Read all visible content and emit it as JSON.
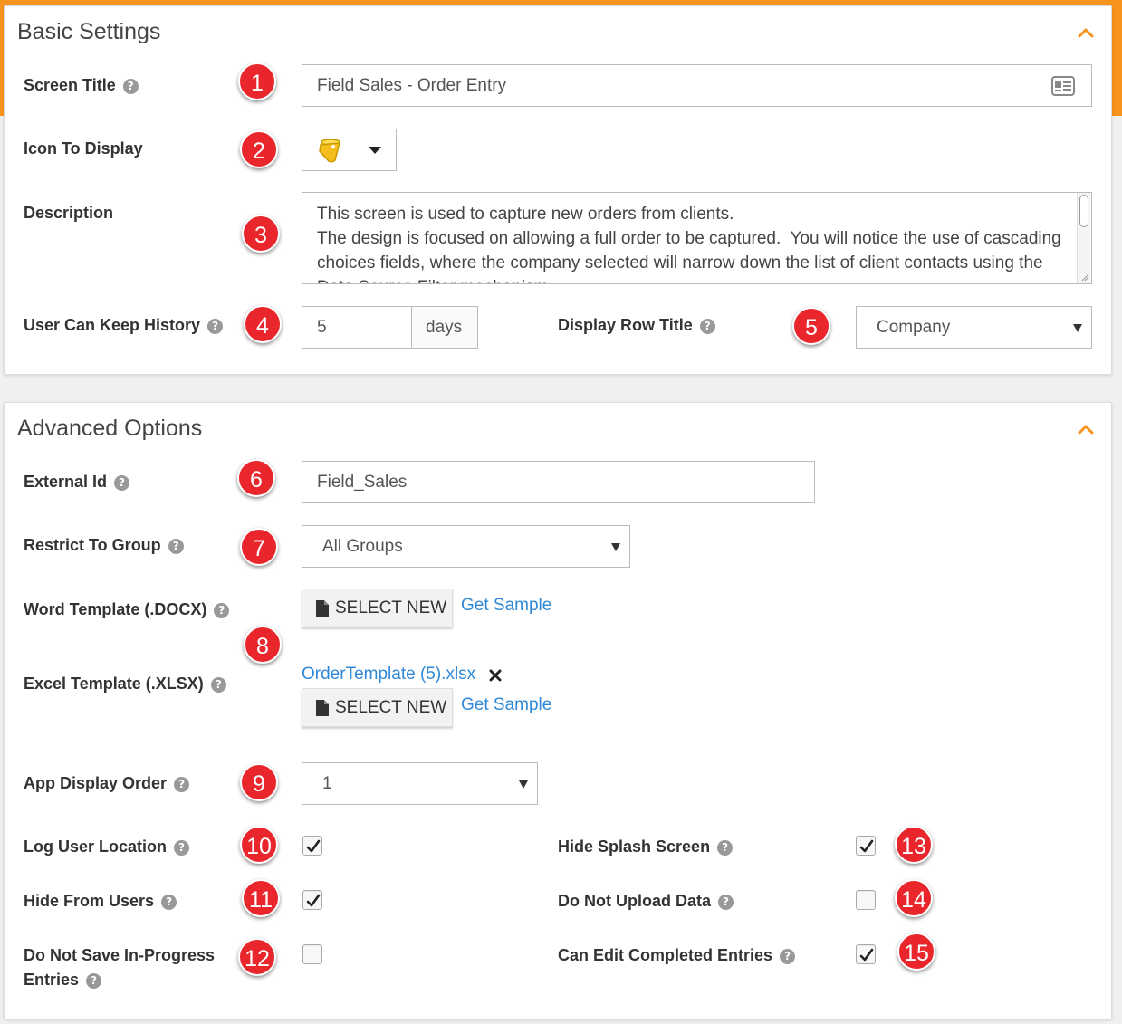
{
  "basic": {
    "title": "Basic Settings",
    "screen_title": {
      "label": "Screen Title",
      "value": "Field Sales - Order Entry",
      "badge": "1"
    },
    "icon_to_display": {
      "label": "Icon To Display",
      "badge": "2"
    },
    "description": {
      "label": "Description",
      "value": "This screen is used to capture new orders from clients.\nThe design is focused on allowing a full order to be captured.  You will notice the use of cascading choices fields, where the company selected will narrow down the list of client contacts using the Data Source Filter mechanism.",
      "badge": "3"
    },
    "keep_history": {
      "label": "User Can Keep History",
      "value": "5",
      "unit": "days",
      "badge": "4"
    },
    "row_title": {
      "label": "Display Row Title",
      "value": "Company",
      "badge": "5"
    }
  },
  "advanced": {
    "title": "Advanced Options",
    "external_id": {
      "label": "External Id",
      "value": "Field_Sales",
      "badge": "6"
    },
    "restrict_group": {
      "label": "Restrict To Group",
      "value": "All Groups",
      "badge": "7"
    },
    "word_template": {
      "label": "Word Template (.DOCX)",
      "button": "SELECT NEW",
      "link": "Get Sample"
    },
    "excel_template": {
      "label": "Excel Template (.XLSX)",
      "file": "OrderTemplate (5).xlsx",
      "button": "SELECT NEW",
      "link": "Get Sample"
    },
    "templates_badge": "8",
    "display_order": {
      "label": "App Display Order",
      "value": "1",
      "badge": "9"
    },
    "log_location": {
      "label": "Log User Location",
      "checked": true,
      "badge": "10"
    },
    "hide_from_users": {
      "label": "Hide From Users",
      "checked": true,
      "badge": "11"
    },
    "no_save_progress": {
      "label_line1": "Do Not Save In-Progress",
      "label_line2": "Entries",
      "checked": false,
      "badge": "12"
    },
    "hide_splash": {
      "label": "Hide Splash Screen",
      "checked": true,
      "badge": "13"
    },
    "no_upload": {
      "label": "Do Not Upload Data",
      "checked": false,
      "badge": "14"
    },
    "edit_completed": {
      "label": "Can Edit Completed Entries",
      "checked": true,
      "badge": "15"
    }
  },
  "colors": {
    "accent": "#f7941d",
    "badge": "#e8262c",
    "link": "#2f88d6"
  },
  "help_glyph": "?"
}
